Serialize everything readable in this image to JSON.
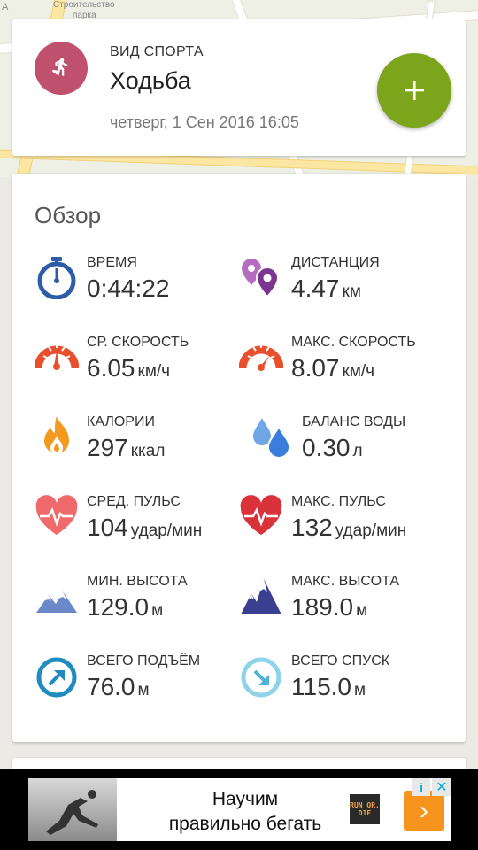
{
  "map": {
    "texts": [
      "А",
      "Строительство",
      "парка"
    ]
  },
  "workout": {
    "sport_label": "ВИД СПОРТА",
    "sport_name": "Ходьба",
    "date": "четверг, 1 Сен 2016 16:05",
    "sport_icon": "walking-icon",
    "sport_color": "#c0516e",
    "add_icon": "plus-icon",
    "add_color": "#7ca51c"
  },
  "overview": {
    "title": "Обзор",
    "stats": [
      {
        "label": "ВРЕМЯ",
        "value": "0:44:22",
        "unit": "",
        "icon": "stopwatch-icon"
      },
      {
        "label": "ДИСТАНЦИЯ",
        "value": "4.47",
        "unit": "км",
        "icon": "distance-pins-icon"
      },
      {
        "label": "СР. СКОРОСТЬ",
        "value": "6.05",
        "unit": "км/ч",
        "icon": "speedometer-icon"
      },
      {
        "label": "МАКС. СКОРОСТЬ",
        "value": "8.07",
        "unit": "км/ч",
        "icon": "max-speedometer-icon"
      },
      {
        "label": "КАЛОРИИ",
        "value": "297",
        "unit": "ккал",
        "icon": "flame-icon"
      },
      {
        "label": "БАЛАНС ВОДЫ",
        "value": "0.30",
        "unit": "л",
        "icon": "water-drops-icon"
      },
      {
        "label": "СРЕД. ПУЛЬС",
        "value": "104",
        "unit": "удар/мин",
        "icon": "heart-pulse-icon"
      },
      {
        "label": "МАКС. ПУЛЬС",
        "value": "132",
        "unit": "удар/мин",
        "icon": "max-heart-pulse-icon"
      },
      {
        "label": "МИН. ВЫСОТА",
        "value": "129.0",
        "unit": "м",
        "icon": "mountains-light-icon"
      },
      {
        "label": "МАКС. ВЫСОТА",
        "value": "189.0",
        "unit": "м",
        "icon": "mountains-dark-icon"
      },
      {
        "label": "ВСЕГО ПОДЪЁМ",
        "value": "76.0",
        "unit": "м",
        "icon": "ascent-arrow-icon"
      },
      {
        "label": "ВСЕГО СПУСК",
        "value": "115.0",
        "unit": "м",
        "icon": "descent-arrow-icon"
      }
    ]
  },
  "ad": {
    "line1": "Научим",
    "line2": "правильно бегать",
    "logo_text": "RUN OR. DIE",
    "info_icon": "info-icon",
    "close_icon": "close-icon",
    "arrow_icon": "chevron-right-icon"
  }
}
